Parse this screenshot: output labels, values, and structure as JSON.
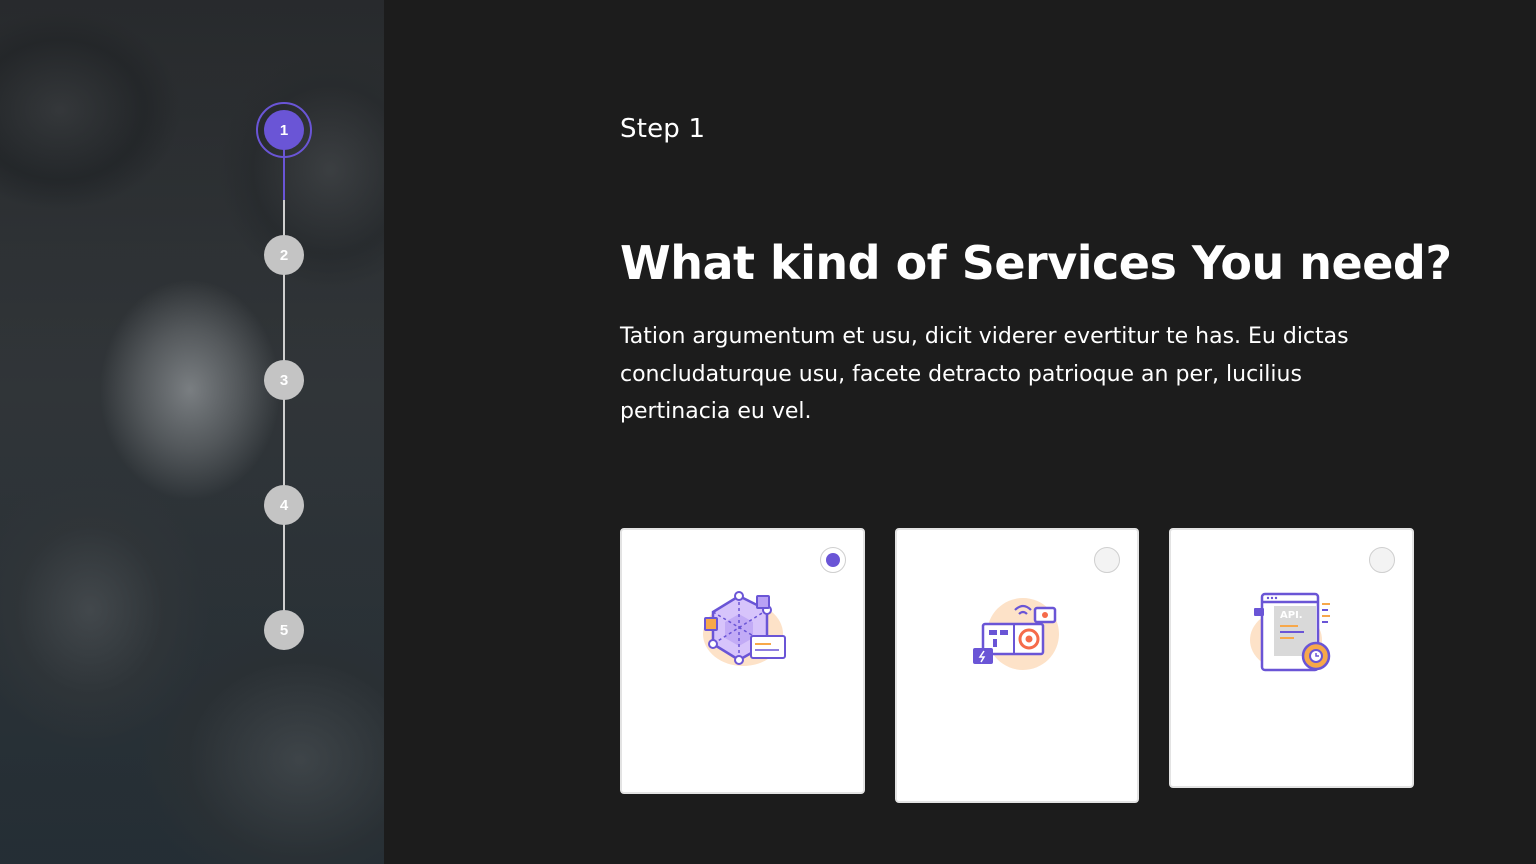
{
  "stepper": {
    "steps": [
      "1",
      "2",
      "3",
      "4",
      "5"
    ],
    "active_step": 1,
    "accent_color": "#6a55d6",
    "inactive_color": "#c4c4c4"
  },
  "content": {
    "step_label": "Step 1",
    "title": "What kind of Services You need?",
    "description": "Tation argumentum et usu, dicit viderer evertitur te has. Eu dictas concludaturque usu, facete detracto patrioque an per, lucilius pertinacia eu vel."
  },
  "services": [
    {
      "icon": "network-hexagon-icon",
      "selected": true
    },
    {
      "icon": "smart-device-icon",
      "selected": false
    },
    {
      "icon": "api-settings-icon",
      "selected": false
    }
  ],
  "card_icon_text": {
    "api": "API."
  }
}
